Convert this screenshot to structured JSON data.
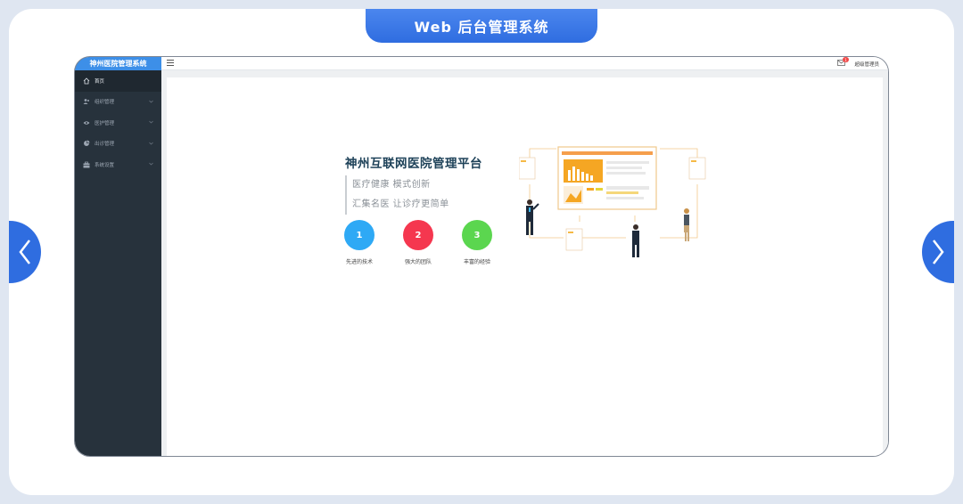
{
  "page": {
    "banner_title": "Web 后台管理系统"
  },
  "sidebar": {
    "brand": "神州医院管理系统",
    "items": [
      {
        "label": "首页",
        "icon": "home-icon",
        "active": true
      },
      {
        "label": "组织管理",
        "icon": "users-icon"
      },
      {
        "label": "医护管理",
        "icon": "eye-icon"
      },
      {
        "label": "出诊管理",
        "icon": "pie-chart-icon"
      },
      {
        "label": "系统设置",
        "icon": "toolbox-icon"
      }
    ]
  },
  "header": {
    "notification_count": "1",
    "user": "超级管理员"
  },
  "main": {
    "title": "神州互联网医院管理平台",
    "slogans": [
      "医疗健康  模式创新",
      "汇集名医  让诊疗更简单"
    ],
    "features": [
      {
        "number": "1",
        "label": "先进的技术",
        "color": "#2ea9f5"
      },
      {
        "number": "2",
        "label": "强大的团队",
        "color": "#f5374f"
      },
      {
        "number": "3",
        "label": "丰富的经验",
        "color": "#5bd64f"
      }
    ]
  }
}
